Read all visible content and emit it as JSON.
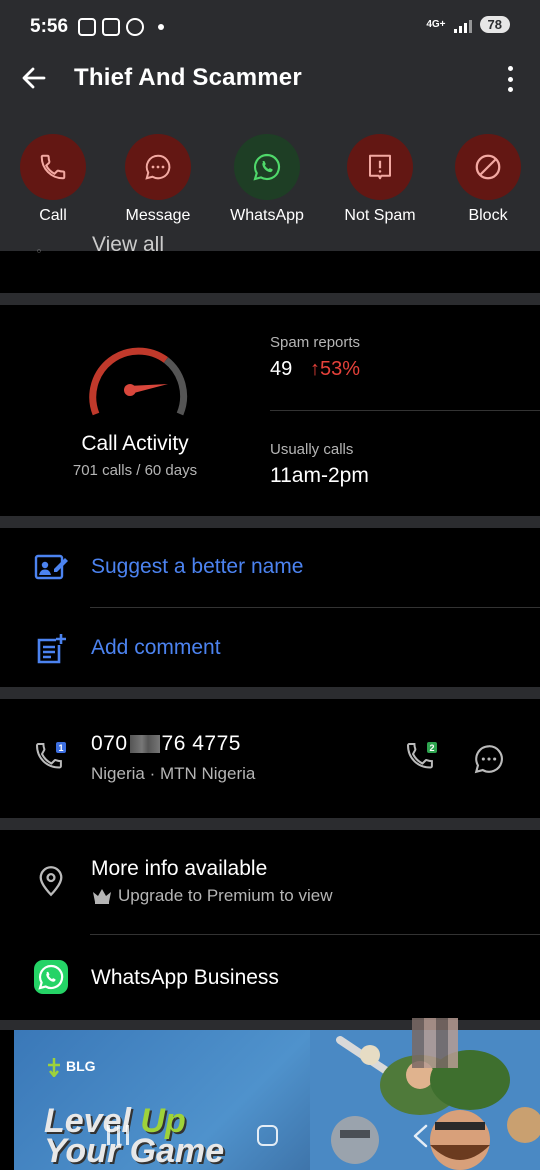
{
  "status_bar": {
    "time": "5:56",
    "network": "4G+",
    "battery": "78"
  },
  "header": {
    "title": "Thief And Scammer"
  },
  "actions": [
    {
      "label": "Call",
      "icon": "phone-icon"
    },
    {
      "label": "Message",
      "icon": "chat-bubble-icon"
    },
    {
      "label": "WhatsApp",
      "icon": "whatsapp-icon"
    },
    {
      "label": "Not Spam",
      "icon": "report-icon"
    },
    {
      "label": "Block",
      "icon": "block-icon"
    }
  ],
  "view_all": {
    "label": "View all"
  },
  "activity": {
    "title": "Call Activity",
    "subtitle": "701 calls / 60 days",
    "spam_reports_label": "Spam reports",
    "spam_reports_value": "49",
    "spam_reports_trend": "↑53%",
    "usually_calls_label": "Usually calls",
    "usually_calls_value": "11am-2pm"
  },
  "links": {
    "suggest": "Suggest a better name",
    "comment": "Add comment"
  },
  "phone": {
    "number_start": "070",
    "number_end": "76 4775",
    "carrier": "Nigeria · MTN Nigeria",
    "sim1_badge": "1",
    "sim2_badge": "2"
  },
  "info": {
    "title": "More info available",
    "subtitle": "Upgrade to Premium to view",
    "whatsapp_business": "WhatsApp Business"
  },
  "ad": {
    "brand": "BLG",
    "line1_a": "Level ",
    "line1_b": "Up",
    "line2": "Your Game"
  },
  "colors": {
    "header_bg": "#2b2c2f",
    "action_red": "#631713",
    "action_green": "#1e3e25",
    "link_blue": "#4c83f0",
    "spam_red": "#e5413a",
    "whatsapp_green": "#25d366"
  }
}
